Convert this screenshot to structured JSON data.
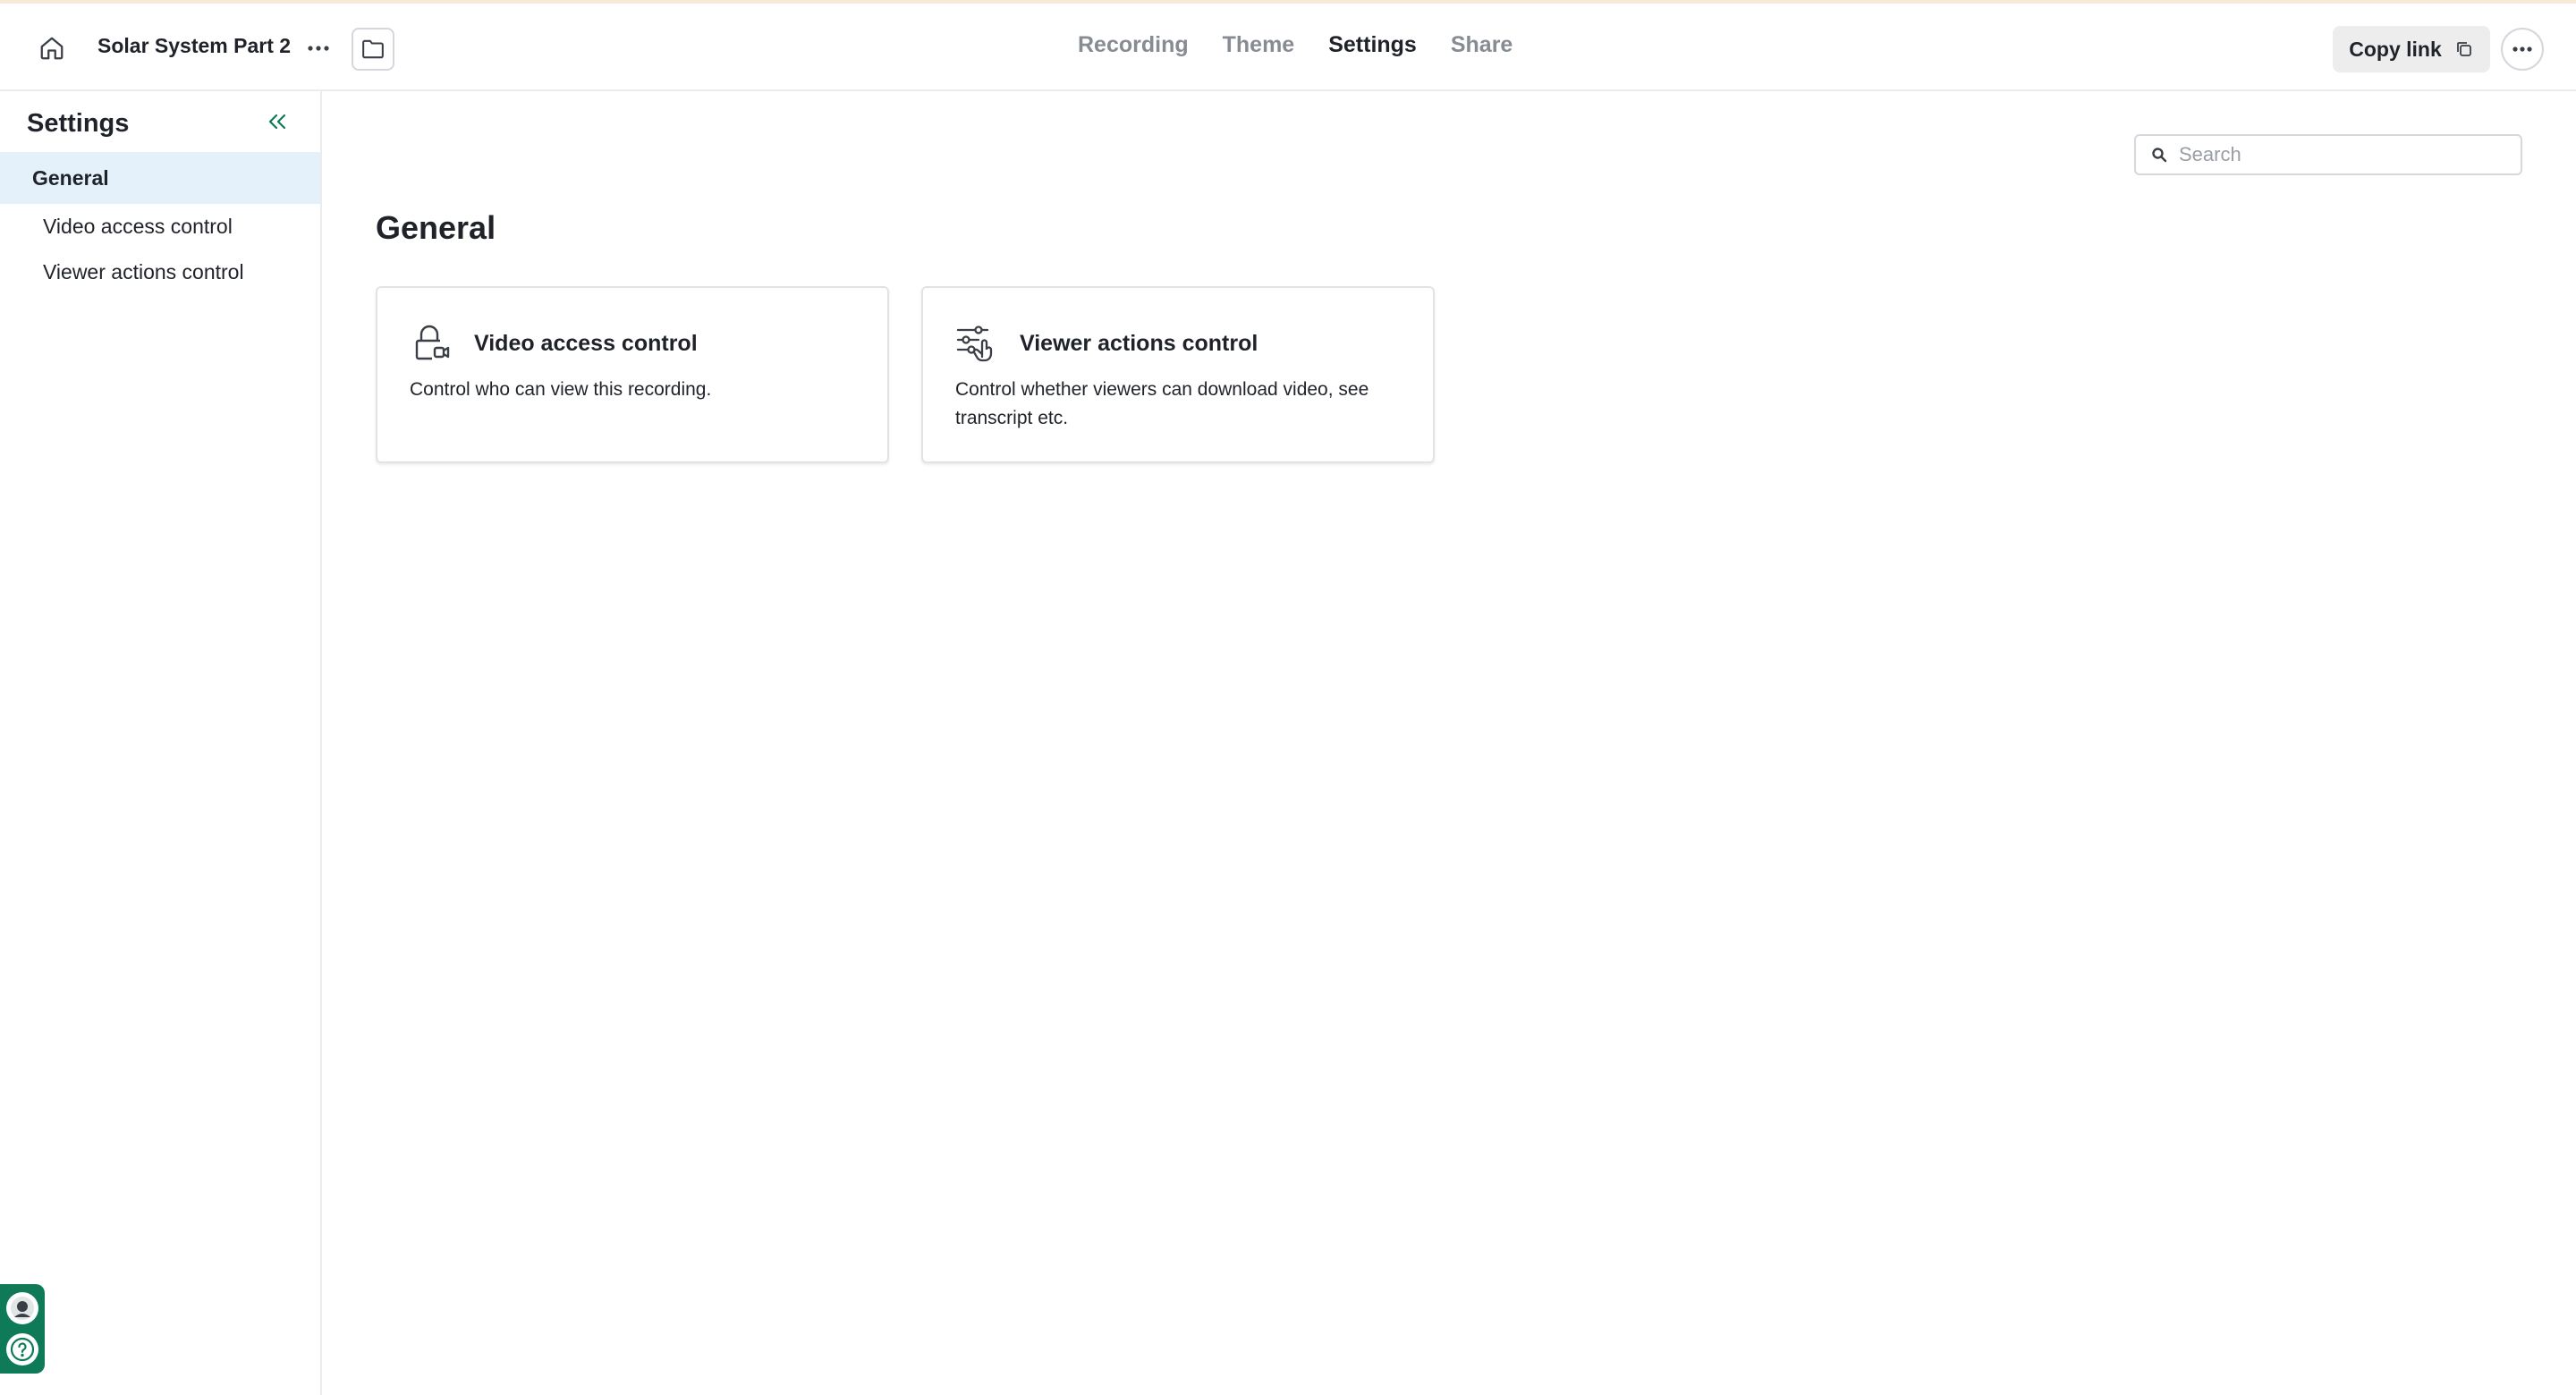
{
  "header": {
    "doc_title": "Solar System Part 2",
    "tabs": [
      {
        "label": "Recording"
      },
      {
        "label": "Theme"
      },
      {
        "label": "Settings"
      },
      {
        "label": "Share"
      }
    ],
    "active_tab": "Settings",
    "copy_link_label": "Copy link",
    "icons": [
      "home-icon",
      "more-horizontal-icon",
      "folder-icon",
      "copy-icon"
    ]
  },
  "sidebar": {
    "title": "Settings",
    "items": [
      {
        "label": "General",
        "active": true
      },
      {
        "label": "Video access control"
      },
      {
        "label": "Viewer actions control"
      }
    ]
  },
  "main": {
    "search_placeholder": "Search",
    "search_value": "",
    "title": "General",
    "cards": [
      {
        "title": "Video access control",
        "description": "Control who can view this recording.",
        "icon": "lock-video-icon"
      },
      {
        "title": "Viewer actions control",
        "description": "Control whether viewers can download video, see transcript etc.",
        "icon": "sliders-hand-icon"
      }
    ]
  },
  "colors": {
    "accent": "#0f7a57",
    "active_nav_bg": "#e4f1fb",
    "muted_tab": "#878c93",
    "text": "#1f2329"
  }
}
